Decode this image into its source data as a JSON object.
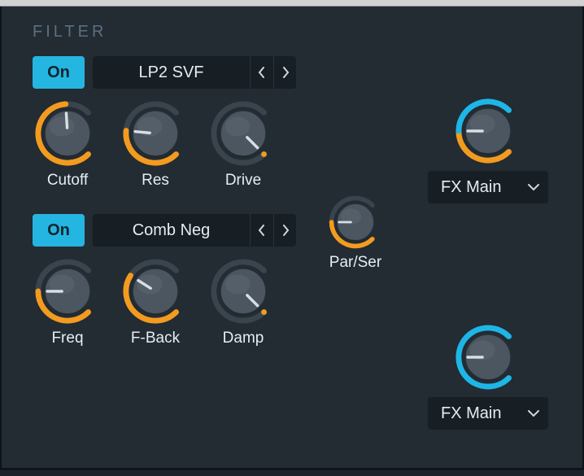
{
  "section": {
    "title": "FILTER"
  },
  "filter1": {
    "on_label": "On",
    "type_label": "LP2 SVF",
    "knobs": {
      "cutoff": {
        "label": "Cutoff",
        "value": 0.82,
        "ring_color": "#f39b1f"
      },
      "res": {
        "label": "Res",
        "value": 0.52,
        "ring_color": "#f39b1f"
      },
      "drive": {
        "label": "Drive",
        "value": 0.0,
        "ring_color": "#f39b1f"
      }
    },
    "route": {
      "knob": {
        "value": 0.5,
        "ring_color_a": "#f39b1f",
        "ring_color_b": "#1eb6e6"
      },
      "selected": "FX Main"
    }
  },
  "filter2": {
    "on_label": "On",
    "type_label": "Comb Neg",
    "knobs": {
      "freq": {
        "label": "Freq",
        "value": 0.5,
        "ring_color": "#f39b1f"
      },
      "fback": {
        "label": "F-Back",
        "value": 0.62,
        "ring_color": "#f39b1f"
      },
      "damp": {
        "label": "Damp",
        "value": 0.0,
        "ring_color": "#f39b1f"
      }
    },
    "route": {
      "knob": {
        "value": 0.5,
        "ring_color_solid": "#1eb6e6"
      },
      "selected": "FX Main"
    }
  },
  "par_ser": {
    "label": "Par/Ser",
    "value": 0.5,
    "ring_color": "#f39b1f"
  },
  "colors": {
    "accent_cyan": "#24b6e0",
    "accent_orange": "#f39b1f",
    "panel_bg": "#232b33",
    "field_bg": "#171e24",
    "text": "#e6edf2"
  }
}
